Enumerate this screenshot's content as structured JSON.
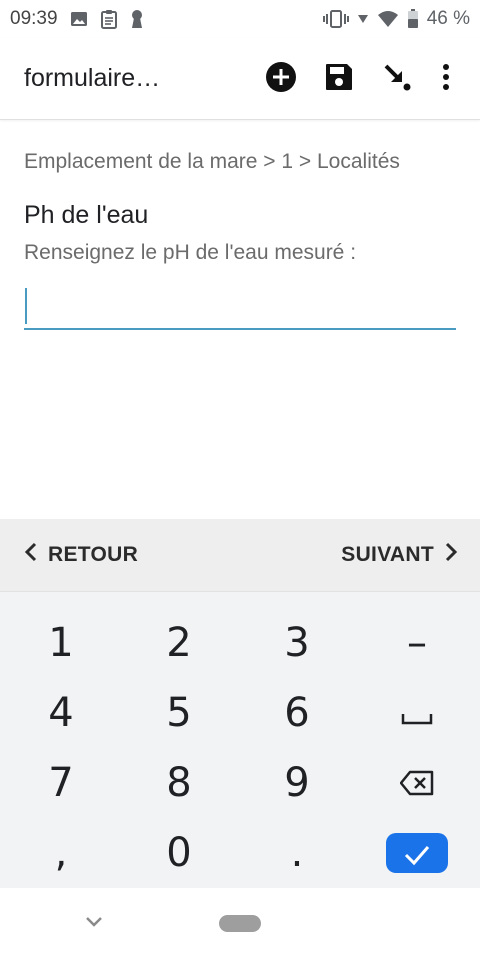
{
  "status_bar": {
    "time": "09:39",
    "battery_percent": "46 %",
    "left_icons": [
      "image-icon",
      "clipboard-icon",
      "keyhole-icon"
    ],
    "right_icons": [
      "vibrate-icon",
      "signal-icon",
      "wifi-icon",
      "battery-icon"
    ]
  },
  "app_bar": {
    "title": "formulaire…",
    "actions": [
      "add-circle-icon",
      "save-icon",
      "go-to-end-icon",
      "more-vert-icon"
    ]
  },
  "content": {
    "breadcrumb": "Emplacement de la mare > 1 > Localités",
    "question_title": "Ph de l'eau",
    "question_hint": "Renseignez le pH de l'eau mesuré :",
    "answer_value": "",
    "accent_color": "#4a9bc2"
  },
  "nav_strip": {
    "back_label": "RETOUR",
    "next_label": "SUIVANT"
  },
  "keyboard": {
    "keys": {
      "k1": "1",
      "k2": "2",
      "k3": "3",
      "minus": "–",
      "k4": "4",
      "k5": "5",
      "k6": "6",
      "k7": "7",
      "k8": "8",
      "k9": "9",
      "comma": ",",
      "k0": "0",
      "period": "."
    },
    "done_color": "#1a73e8"
  }
}
